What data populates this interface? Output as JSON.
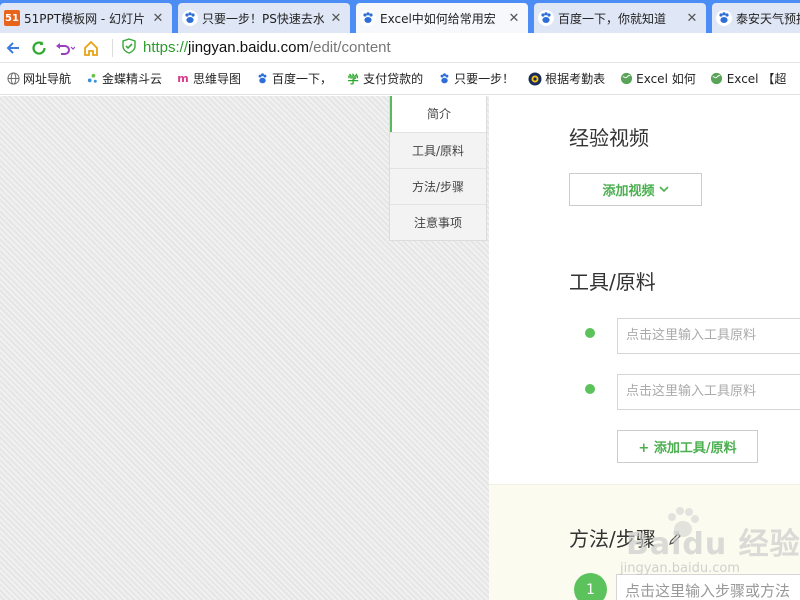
{
  "tabs": [
    {
      "title": "51PPT模板网 - 幻灯片",
      "favicon": "51ppt-icon",
      "active": false
    },
    {
      "title": "只要一步！PS快速去水",
      "favicon": "baidu-paw-icon",
      "active": false
    },
    {
      "title": "Excel中如何给常用宏",
      "favicon": "baidu-paw-icon",
      "active": true
    },
    {
      "title": "百度一下，你就知道",
      "favicon": "baidu-paw-icon",
      "active": false
    },
    {
      "title": "泰安天气预报",
      "favicon": "baidu-paw-icon",
      "active": false
    }
  ],
  "toolbar": {
    "url_scheme": "https://",
    "url_host": "jingyan.baidu.com",
    "url_path": "/edit/content"
  },
  "bookmarks": [
    {
      "label": "网址导航",
      "icon": "globe-icon"
    },
    {
      "label": "金蝶精斗云",
      "icon": "kingdee-icon"
    },
    {
      "label": "思维导图",
      "icon": "mindmap-icon"
    },
    {
      "label": "百度一下，",
      "icon": "baidu-paw-icon"
    },
    {
      "label": "支付贷款的",
      "icon": "xue-icon"
    },
    {
      "label": "只要一步！",
      "icon": "baidu-paw-icon"
    },
    {
      "label": "根据考勤表",
      "icon": "app-icon"
    },
    {
      "label": "Excel 如何",
      "icon": "globe-icon"
    },
    {
      "label": "Excel 【超",
      "icon": "globe-icon"
    }
  ],
  "side_nav": {
    "items": [
      "简介",
      "工具/原料",
      "方法/步骤",
      "注意事项"
    ],
    "active_index": 0
  },
  "content": {
    "video_title": "经验视频",
    "add_video_label": "添加视频",
    "tools_title": "工具/原料",
    "tool_placeholder": "点击这里输入工具原料",
    "add_tool_label": "+ 添加工具/原料",
    "method_title": "方法/步骤",
    "step_number": "1",
    "step_placeholder": "点击这里输入步骤或方法"
  },
  "watermark": {
    "text": "Baidu 经验",
    "url": "jingyan.baidu.com"
  },
  "colors": {
    "tabbar": "#4c8df5",
    "accent_green": "#5cc25c",
    "button_text_green": "#4caf50"
  }
}
